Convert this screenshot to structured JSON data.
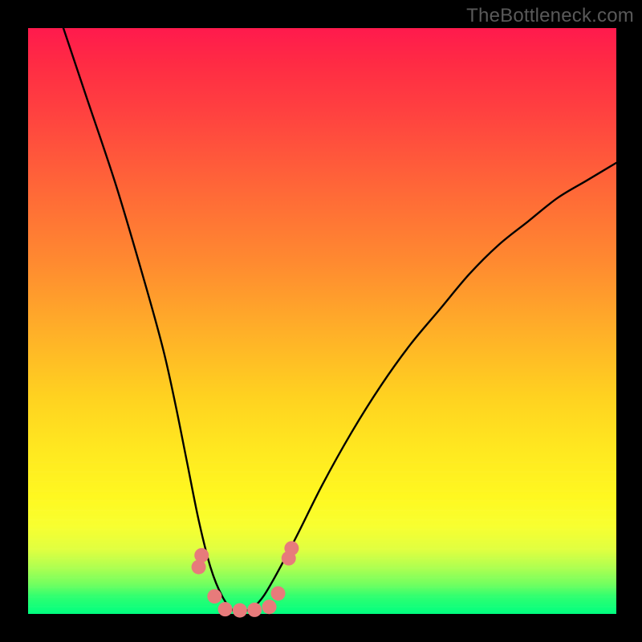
{
  "watermark": "TheBottleneck.com",
  "chart_data": {
    "type": "line",
    "title": "",
    "xlabel": "",
    "ylabel": "",
    "xlim": [
      0,
      100
    ],
    "ylim": [
      0,
      100
    ],
    "grid": false,
    "legend": false,
    "series": [
      {
        "name": "bottleneck-curve",
        "x": [
          6,
          10,
          15,
          20,
          23,
          25,
          27,
          29,
          31,
          33,
          35,
          37,
          40,
          45,
          50,
          55,
          60,
          65,
          70,
          75,
          80,
          85,
          90,
          95,
          100
        ],
        "values": [
          100,
          88,
          73,
          56,
          45,
          36,
          26,
          16,
          8,
          3,
          0.5,
          0.5,
          3,
          12,
          22,
          31,
          39,
          46,
          52,
          58,
          63,
          67,
          71,
          74,
          77
        ]
      }
    ],
    "markers": [
      {
        "name": "marker-left-upper",
        "x": 29.5,
        "y": 10,
        "color": "#e77b7b",
        "r": 9
      },
      {
        "name": "marker-left-upper2",
        "x": 29.0,
        "y": 8,
        "color": "#e77b7b",
        "r": 9
      },
      {
        "name": "marker-left-lower",
        "x": 31.7,
        "y": 3.0,
        "color": "#e77b7b",
        "r": 9
      },
      {
        "name": "marker-bottom-1",
        "x": 33.5,
        "y": 0.8,
        "color": "#e77b7b",
        "r": 9
      },
      {
        "name": "marker-bottom-2",
        "x": 36.0,
        "y": 0.6,
        "color": "#e77b7b",
        "r": 9
      },
      {
        "name": "marker-bottom-3",
        "x": 38.5,
        "y": 0.7,
        "color": "#e77b7b",
        "r": 9
      },
      {
        "name": "marker-bottom-4",
        "x": 41.0,
        "y": 1.2,
        "color": "#e77b7b",
        "r": 9
      },
      {
        "name": "marker-right-lower",
        "x": 42.5,
        "y": 3.5,
        "color": "#e77b7b",
        "r": 9
      },
      {
        "name": "marker-right-upper",
        "x": 44.3,
        "y": 9.5,
        "color": "#e77b7b",
        "r": 9
      },
      {
        "name": "marker-right-upper2",
        "x": 44.8,
        "y": 11.2,
        "color": "#e77b7b",
        "r": 9
      }
    ],
    "gradient_stops": [
      {
        "pos": 0,
        "color": "#ff1a4d"
      },
      {
        "pos": 40,
        "color": "#ff8a30"
      },
      {
        "pos": 72,
        "color": "#ffe820"
      },
      {
        "pos": 100,
        "color": "#00ff80"
      }
    ]
  }
}
